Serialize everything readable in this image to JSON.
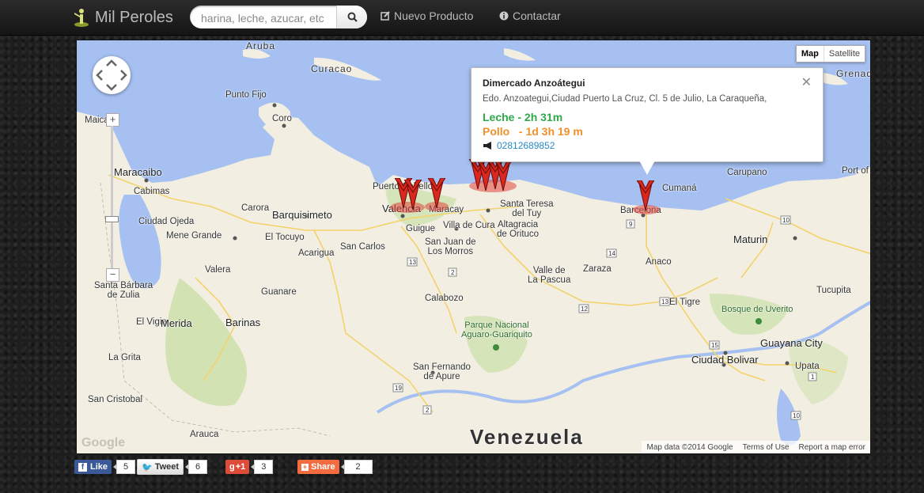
{
  "brand": {
    "name": "Mil Peroles",
    "icon": "person-flag-icon"
  },
  "search": {
    "placeholder": "harina, leche, azucar, etc",
    "button_icon": "search-icon"
  },
  "nav": [
    {
      "label": "Nuevo Producto",
      "icon": "edit-icon"
    },
    {
      "label": "Contactar",
      "icon": "info-icon"
    }
  ],
  "map": {
    "type_buttons": [
      "Map",
      "Satellite"
    ],
    "active_type": "Map",
    "zoom_plus": "+",
    "zoom_minus": "−",
    "country_label": "Venezuela",
    "labels": {
      "aruba": "Aruba",
      "curacao": "Curacao",
      "grenada": "Grenad",
      "punto_fijo": "Punto Fijo",
      "coro": "Coro",
      "maicao": "Maicao",
      "maracaibo": "Maracaibo",
      "cabimas": "Cabimas",
      "ciudad_ojeda": "Ciudad Ojeda",
      "mene_grande": "Mene Grande",
      "carora": "Carora",
      "barquisimeto": "Barquisimeto",
      "el_tocuyo": "El Tocuyo",
      "acarigua": "Acarigua",
      "san_carlos": "San Carlos",
      "valera": "Valera",
      "santa_barbara": "Santa Bárbara\nde Zulia",
      "guanare": "Guanare",
      "el_vigia": "El Vigia",
      "merida": "Merida",
      "barinas": "Barinas",
      "la_grita": "La Grita",
      "san_cristobal": "San Cristobal",
      "arauca": "Arauca",
      "puerto_cabello": "Puerto Cabello",
      "valencia": "Valencia",
      "maracay": "Maracay",
      "guigue": "Guigue",
      "villa_de_cura": "Villa de Cura",
      "san_juan": "San Juan de\nLos Morros",
      "santa_teresa": "Santa Teresa\ndel Tuy",
      "altagracia": "Altagracia\nde Orituco",
      "valle_de_la_pascua": "Valle de\nLa Pascua",
      "zaraza": "Zaraza",
      "calabozo": "Calabozo",
      "barcelona": "Barcelona",
      "cumana": "Cumaná",
      "carupano": "Carupano",
      "port_of_spain": "Port of",
      "maturin": "Maturin",
      "anaco": "Anaco",
      "el_tigre": "El Tigre",
      "tucupita": "Tucupita",
      "bosque_uverito": "Bosque de Uverito",
      "guayana": "Guayana City",
      "ciudad_bolivar": "Ciudad Bolivar",
      "upata": "Upata",
      "parque_aguaro": "Parque Nacional\nAguaro-Guariquito",
      "san_fernando": "San Fernando\nde Apure"
    },
    "infowindow": {
      "title": "Dimercado Anzoátegui",
      "address": "Edo. Anzoategui,Ciudad Puerto La Cruz, Cl. 5 de Julio, La Caraqueña,",
      "line1": "Leche - 2h 31m",
      "line2": "Pollo   - 1d 3h 19 m",
      "phone": "02812689852",
      "phone_icon": "megaphone-icon",
      "close_icon": "close-icon",
      "line1_color": "#2fa84a",
      "line2_color": "#f0902c"
    },
    "footer": {
      "attribution": "Map data ©2014 Google",
      "terms": "Terms of Use",
      "report": "Report a map error"
    },
    "logo": "Google"
  },
  "social": [
    {
      "label": "Like",
      "count": "5",
      "color": "#3b5998",
      "icon": "facebook-icon"
    },
    {
      "label": "Tweet",
      "count": "6",
      "color": "#eeeeee",
      "icon": "twitter-icon"
    },
    {
      "label": "+1",
      "count": "3",
      "color": "#dd4b39",
      "icon": "googleplus-icon"
    },
    {
      "label": "Share",
      "count": "2",
      "color": "#f26c3f",
      "icon": "share-icon"
    }
  ]
}
